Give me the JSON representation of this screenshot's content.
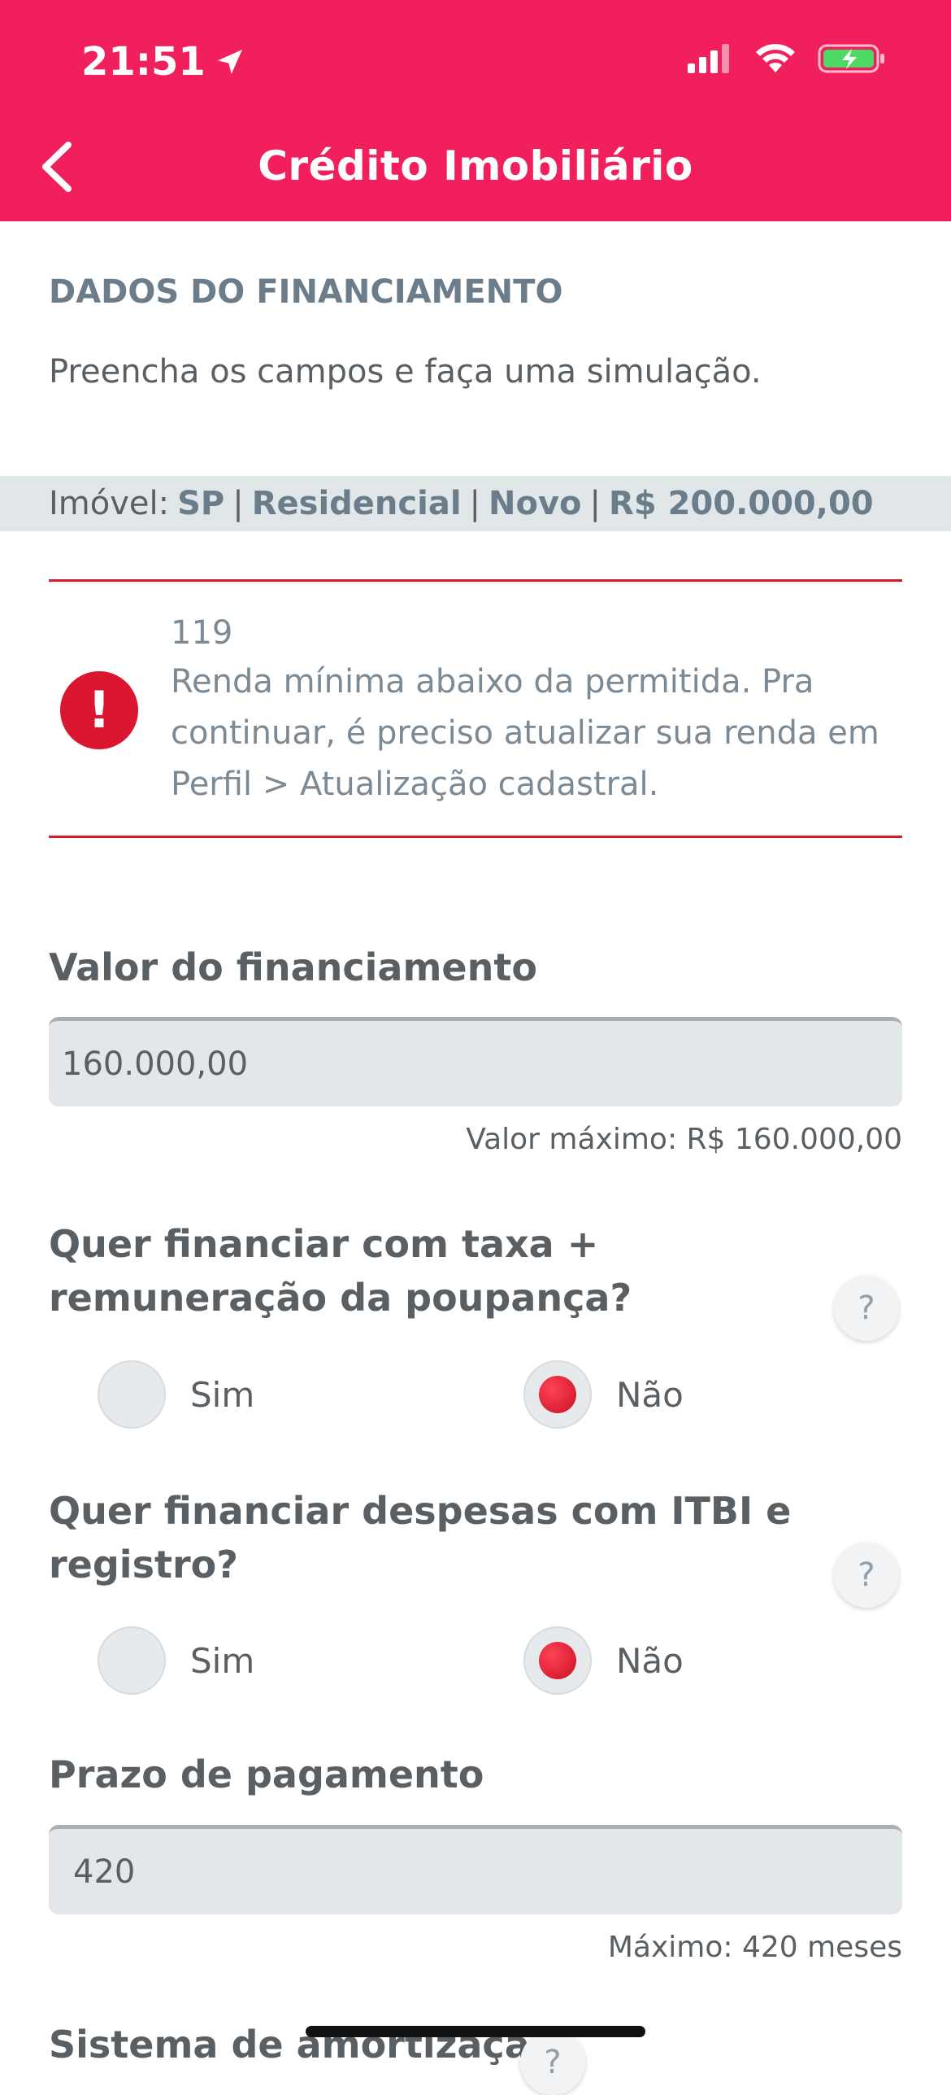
{
  "status_bar": {
    "time": "21:51"
  },
  "header": {
    "title": "Crédito Imobiliário"
  },
  "section": {
    "title": "DADOS DO FINANCIAMENTO",
    "intro": "Preencha os campos e faça uma simulação."
  },
  "imovel": {
    "label": "Imóvel:",
    "state": "SP",
    "type": "Residencial",
    "condition": "Novo",
    "value": "R$ 200.000,00",
    "separator": "|"
  },
  "alert": {
    "code": "119",
    "message": "Renda mínima abaixo da permitida. Pra continuar, é preciso atualizar sua renda em Perfil > Atualização cadastral."
  },
  "financing_value": {
    "label": "Valor do financiamento",
    "value": "160.000,00",
    "hint": "Valor máximo: R$ 160.000,00"
  },
  "question_savings": {
    "text": "Quer financiar com taxa + remuneração da poupança?",
    "yes": "Sim",
    "no": "Não",
    "selected": "no"
  },
  "question_itbi": {
    "text": "Quer financiar despesas com ITBI e registro?",
    "yes": "Sim",
    "no": "Não",
    "selected": "no"
  },
  "term": {
    "label": "Prazo de pagamento",
    "value": "420",
    "hint": "Máximo: 420 meses"
  },
  "amortization": {
    "label": "Sistema de amortização"
  },
  "help_glyph": "?",
  "colors": {
    "brand": "#f21f5d",
    "alert": "#da1630"
  }
}
